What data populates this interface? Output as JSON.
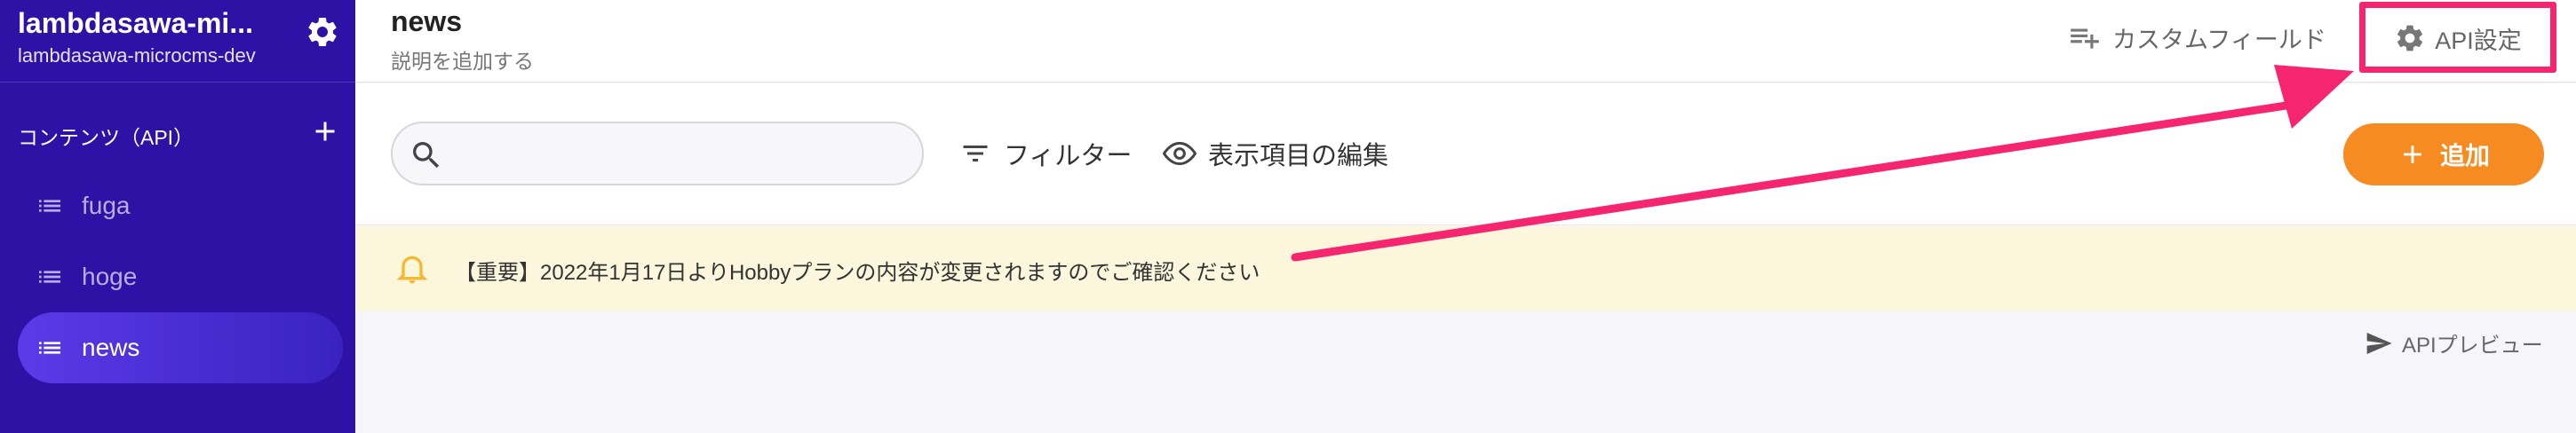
{
  "sidebar": {
    "service_name": "lambdasawa-mi...",
    "service_id": "lambdasawa-microcms-dev",
    "section_label": "コンテンツ（API）",
    "items": [
      {
        "label": "fuga"
      },
      {
        "label": "hoge"
      },
      {
        "label": "news"
      }
    ],
    "active_item": "news"
  },
  "header": {
    "title": "news",
    "description_placeholder": "説明を追加する",
    "custom_field_label": "カスタムフィールド",
    "api_settings_label": "API設定"
  },
  "toolbar": {
    "search_value": "",
    "filter_label": "フィルター",
    "columns_label": "表示項目の編集",
    "add_label": "追加"
  },
  "notice": {
    "text": "【重要】2022年1月17日よりHobbyプランの内容が変更されますのでご確認ください"
  },
  "content": {
    "preview_label": "APIプレビュー"
  },
  "colors": {
    "sidebar_bg": "#2c12a5",
    "accent": "#f68b22",
    "annotation": "#f5256f",
    "notice_bg": "#fbf6dc",
    "bell": "#f5b82e"
  },
  "icons": {
    "sidebar_gear": "gear-icon",
    "sidebar_add": "plus-icon",
    "list": "list-icon",
    "custom_field": "playlist-add-icon",
    "api_settings": "gear-icon",
    "search": "search-icon",
    "filter": "filter-icon",
    "columns": "eye-icon",
    "add": "plus-icon",
    "notice": "bell-icon",
    "preview": "send-icon"
  }
}
